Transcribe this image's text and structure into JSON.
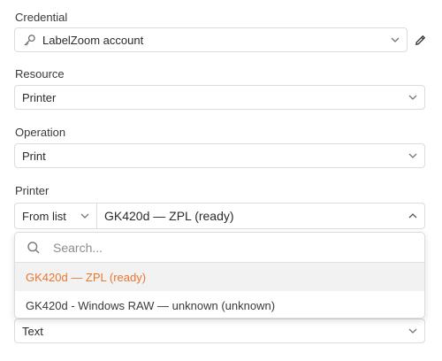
{
  "credential": {
    "label": "Credential",
    "value": "LabelZoom account",
    "icon": "key-icon"
  },
  "resource": {
    "label": "Resource",
    "value": "Printer"
  },
  "operation": {
    "label": "Operation",
    "value": "Print"
  },
  "printer": {
    "label": "Printer",
    "mode": "From list",
    "value": "GK420d — ZPL (ready)",
    "search_placeholder": "Search...",
    "options": [
      {
        "label": "GK420d — ZPL (ready)",
        "selected": true
      },
      {
        "label": "GK420d - Windows RAW — unknown (unknown)",
        "selected": false
      }
    ]
  },
  "format": {
    "value": "Text"
  },
  "colors": {
    "accent": "#e8772e",
    "border": "#dcdcdc",
    "hover": "#f2f2f2"
  }
}
